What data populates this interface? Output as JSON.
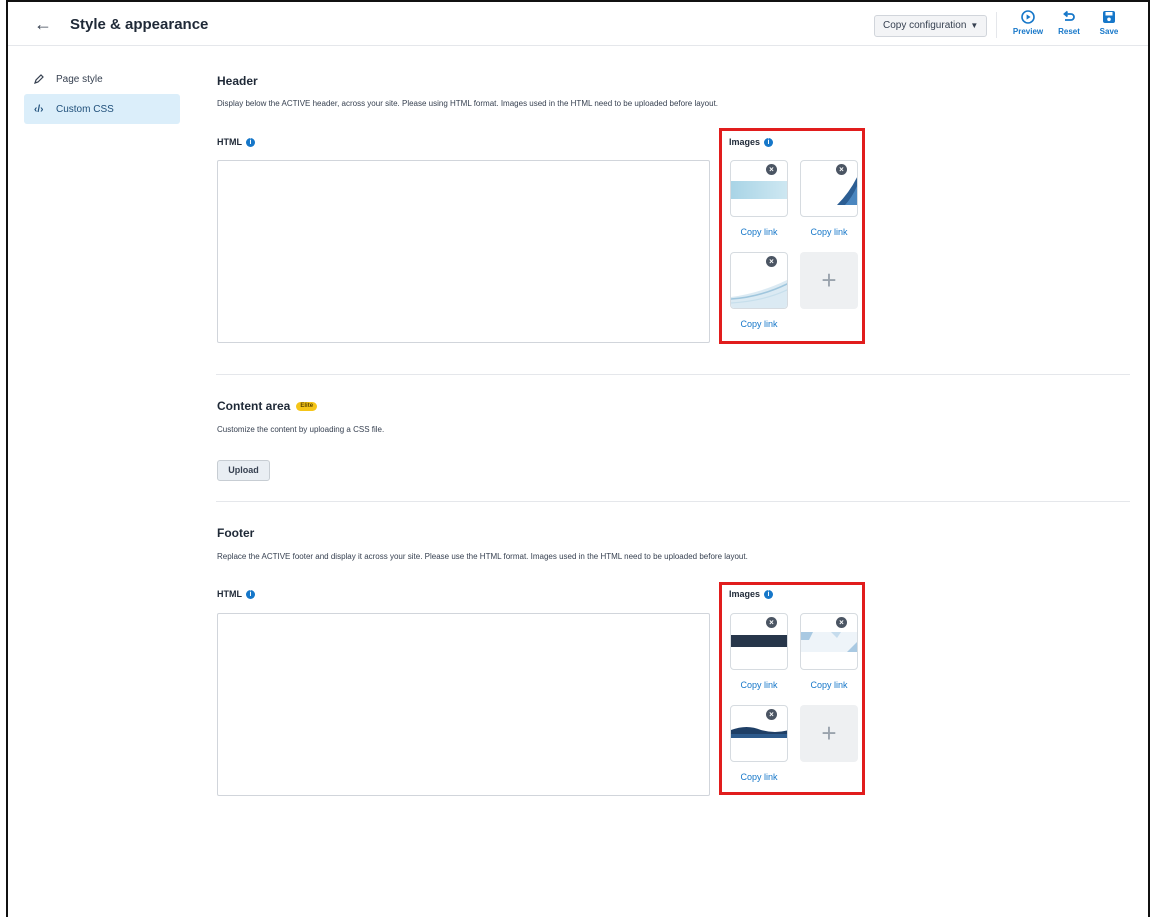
{
  "header": {
    "back_icon": "arrow-left-icon",
    "title": "Style & appearance",
    "copy_config_label": "Copy configuration",
    "preview_label": "Preview",
    "reset_label": "Reset",
    "save_label": "Save",
    "accent_color": "#1677c9"
  },
  "sidebar": {
    "items": [
      {
        "label": "Page style",
        "icon": "pencil-icon",
        "active": false
      },
      {
        "label": "Custom CSS",
        "icon": "code-icon",
        "active": true
      }
    ]
  },
  "header_section": {
    "title": "Header",
    "description": "Display below the ACTIVE header, across your site. Please using HTML format. Images used in the HTML need to be uploaded before layout.",
    "html_label": "HTML",
    "images_label": "Images",
    "copy_link": "Copy link"
  },
  "content_section": {
    "title": "Content area",
    "badge": "Elite",
    "description": "Customize the content by uploading a CSS file.",
    "upload_label": "Upload"
  },
  "footer_section": {
    "title": "Footer",
    "description": "Replace the ACTIVE footer and display it across your site. Please use the HTML format. Images used in the HTML need to be uploaded before layout.",
    "html_label": "HTML",
    "images_label": "Images",
    "copy_link": "Copy link"
  },
  "highlight_color": "#e11d1d"
}
